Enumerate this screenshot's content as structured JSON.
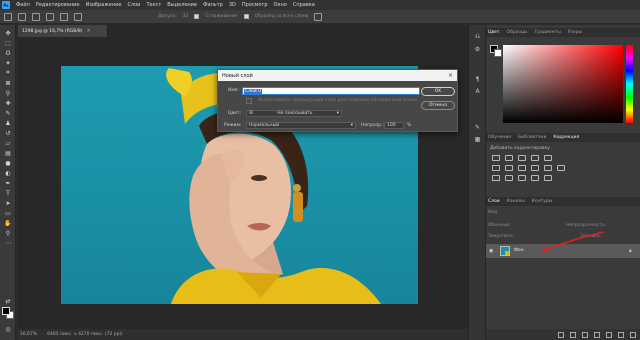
{
  "menu": {
    "logo": "Ps",
    "items": [
      "Файл",
      "Редактирование",
      "Изображение",
      "Слои",
      "Текст",
      "Выделение",
      "Фильтр",
      "3D",
      "Просмотр",
      "Окно",
      "Справка"
    ]
  },
  "options": {
    "opacity_label": "Допуск:",
    "opacity_value": "32",
    "smooth_label": "Сглаживание",
    "sample_label": "Образец со всех слоев"
  },
  "document": {
    "tab_title": "1298.jpg @ 16,7% (RGB/8)",
    "tab_close": "×"
  },
  "status": {
    "zoom": "16,67%",
    "size": "6405 пикс. x 4270 пикс. (72 ppi)"
  },
  "dialog": {
    "title": "Новый слой",
    "close": "×",
    "name_label": "Имя:",
    "name_value": "Слой 0",
    "clip_hint": "Использовать предыдущий слой для создания обтравочной маски",
    "color_label": "Цвет:",
    "color_value": "Не показывать",
    "mode_label": "Режим:",
    "mode_value": "Нормальный",
    "opacity_label": "Непрозр.:",
    "opacity_value": "100",
    "opacity_unit": "%",
    "ok_label": "OK",
    "cancel_label": "Отмена"
  },
  "color_panel": {
    "tabs": [
      "Цвет",
      "Образцы",
      "Градиенты",
      "Узоры"
    ],
    "active": 0
  },
  "adjust_panel": {
    "tabs": [
      "Обучение",
      "Библиотеки",
      "Коррекция"
    ],
    "active": 2,
    "add_label": "Добавить корректировку"
  },
  "layers_panel": {
    "tabs": [
      "Слои",
      "Каналы",
      "Контуры"
    ],
    "active": 0,
    "kind_label": "Вид",
    "mode_label": "Обычные",
    "opacity_label": "Непрозрачность:",
    "lock_label": "Закрепить:",
    "fill_label": "Заливка:",
    "layer_name": "Фон"
  },
  "colors": {
    "foreground": "#000000",
    "background": "#ffffff",
    "accent": "#2f7ed8",
    "arrow": "#e02020"
  }
}
